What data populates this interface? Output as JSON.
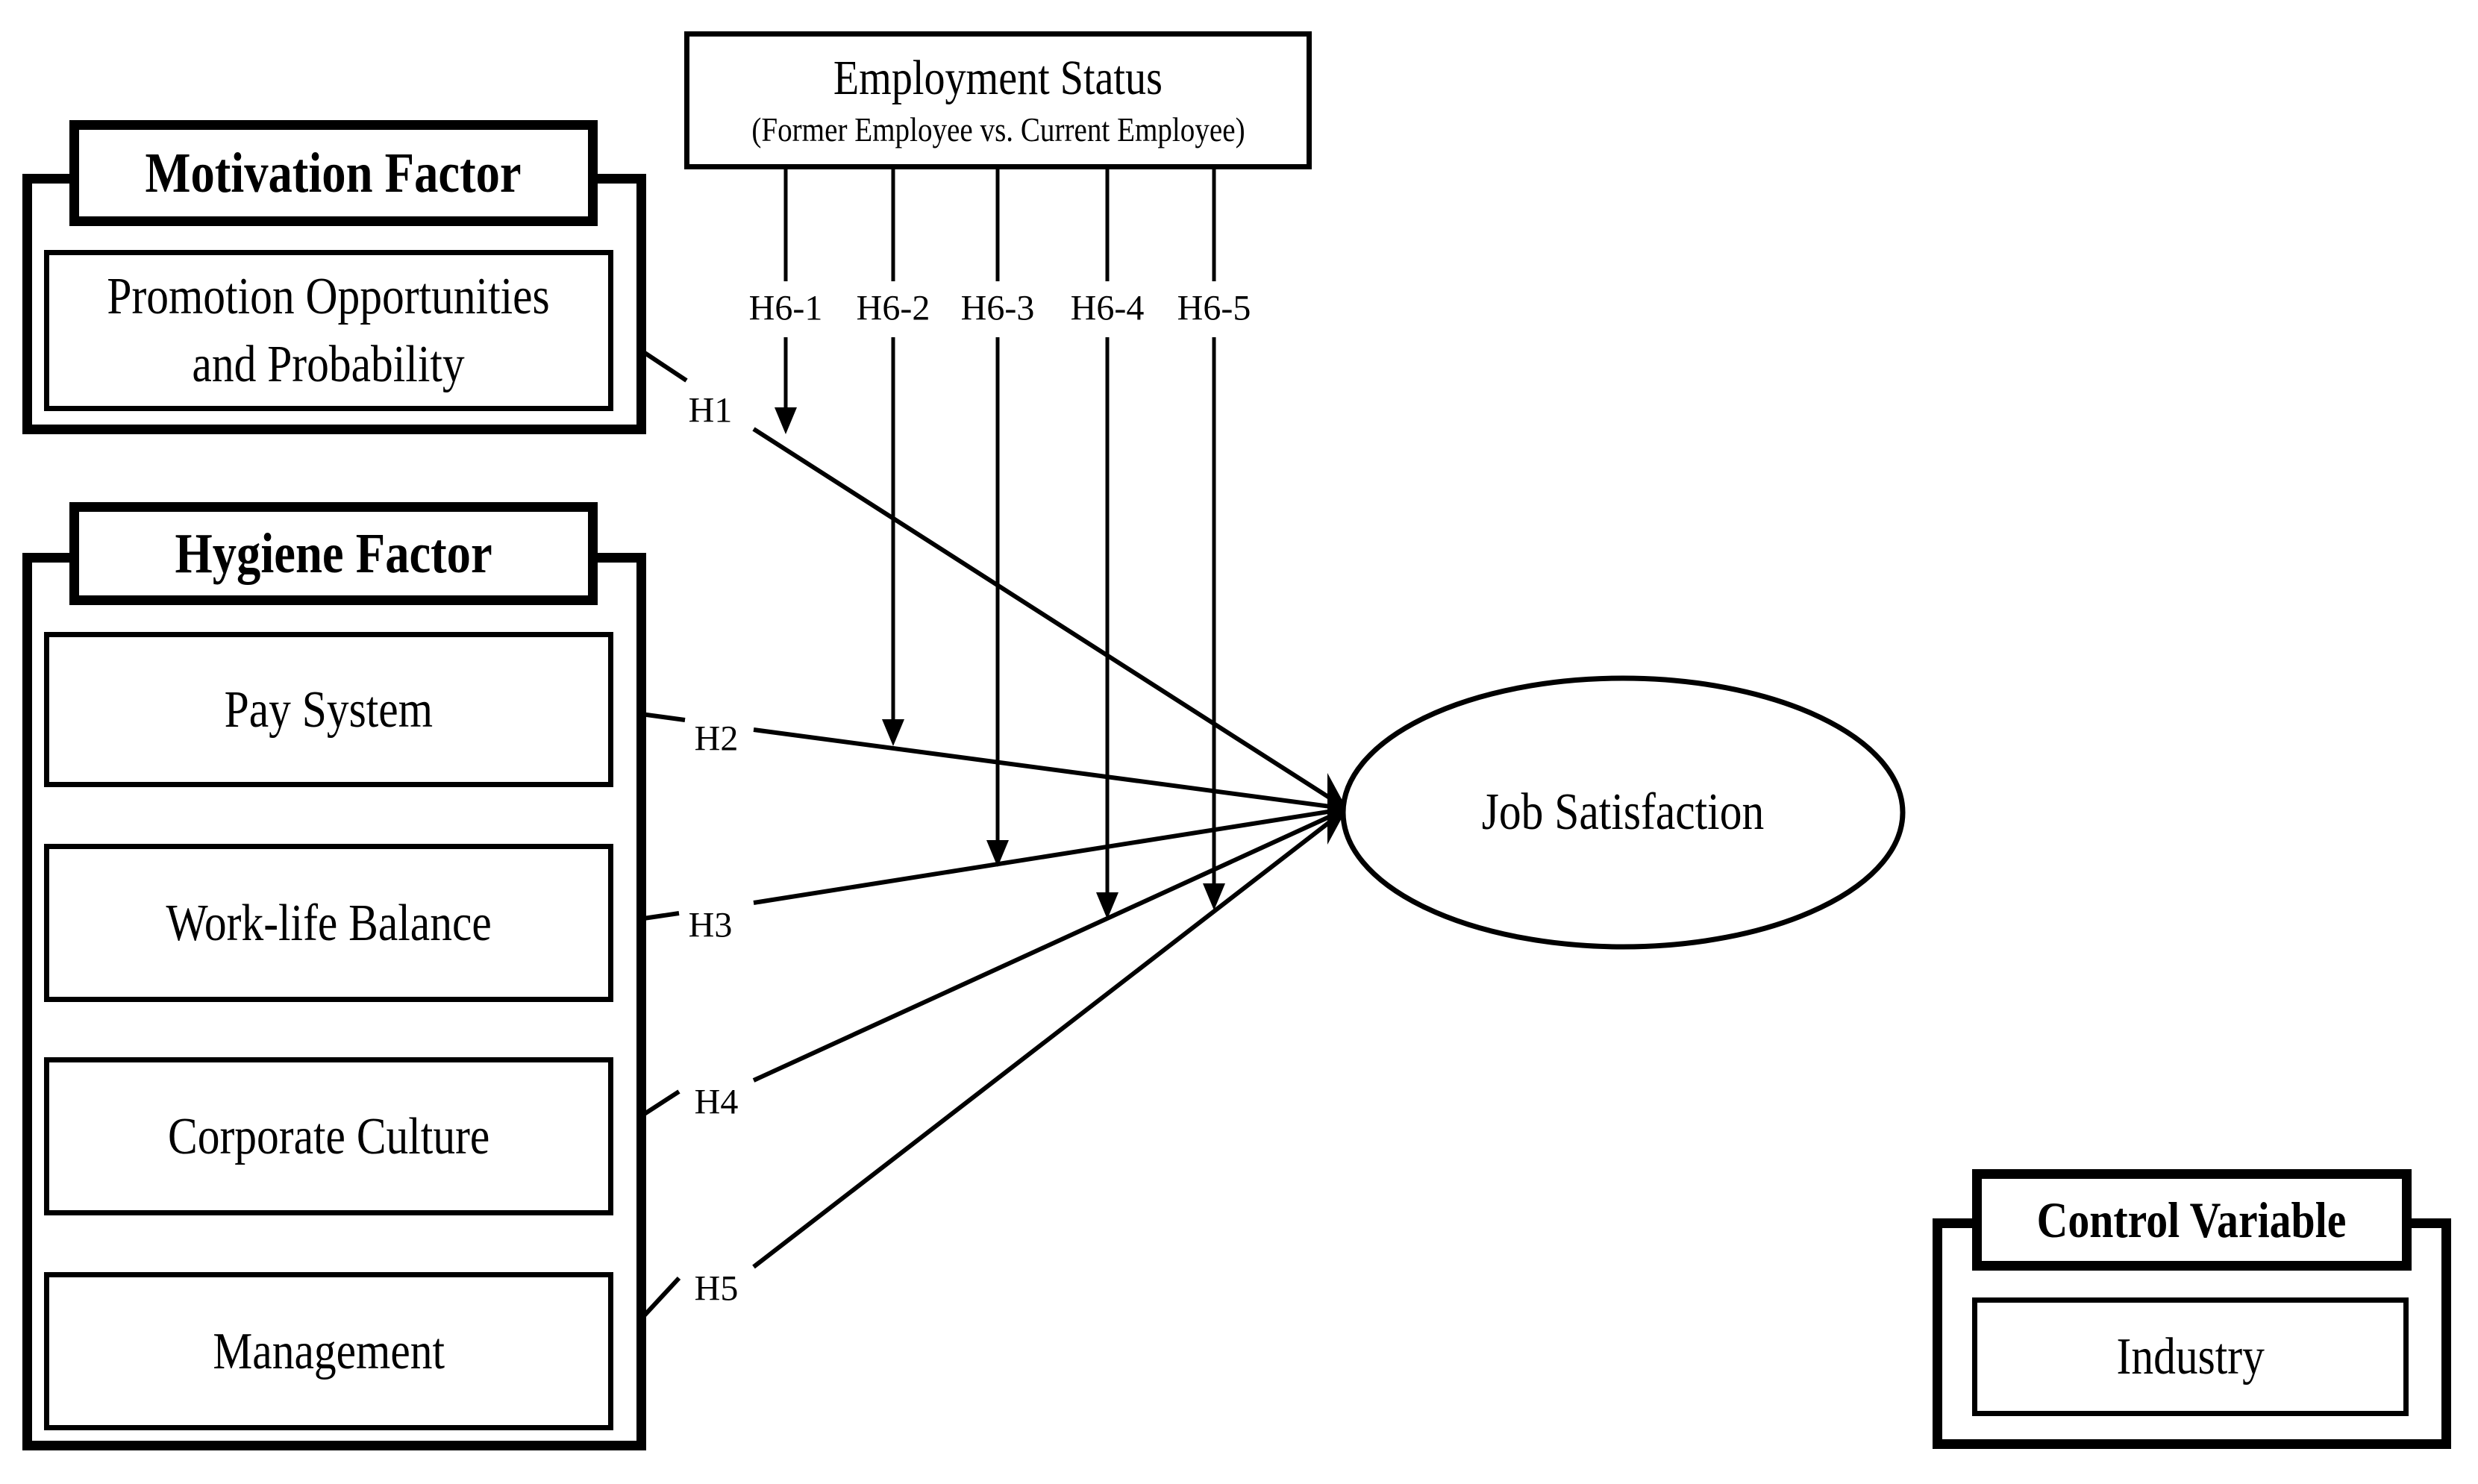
{
  "diagram": {
    "motivation_group": {
      "title": "Motivation Factor",
      "items": [
        "Promotion Opportunities\nand Probability"
      ]
    },
    "hygiene_group": {
      "title": "Hygiene Factor",
      "items": [
        "Pay System",
        "Work-life Balance",
        "Corporate Culture",
        "Management"
      ]
    },
    "moderator": {
      "title": "Employment Status",
      "subtitle": "(Former Employee vs. Current Employee)"
    },
    "outcome": "Job Satisfaction",
    "control_group": {
      "title": "Control Variable",
      "items": [
        "Industry"
      ]
    },
    "hypotheses": {
      "direct": [
        "H1",
        "H2",
        "H3",
        "H4",
        "H5"
      ],
      "moderation": [
        "H6-1",
        "H6-2",
        "H6-3",
        "H6-4",
        "H6-5"
      ]
    },
    "edges": [
      {
        "from": "Promotion Opportunities and Probability",
        "to": "Job Satisfaction",
        "label": "H1"
      },
      {
        "from": "Pay System",
        "to": "Job Satisfaction",
        "label": "H2"
      },
      {
        "from": "Work-life Balance",
        "to": "Job Satisfaction",
        "label": "H3"
      },
      {
        "from": "Corporate Culture",
        "to": "Job Satisfaction",
        "label": "H4"
      },
      {
        "from": "Management",
        "to": "Job Satisfaction",
        "label": "H5"
      },
      {
        "from": "Employment Status",
        "to": "H1 path",
        "label": "H6-1"
      },
      {
        "from": "Employment Status",
        "to": "H2 path",
        "label": "H6-2"
      },
      {
        "from": "Employment Status",
        "to": "H3 path",
        "label": "H6-3"
      },
      {
        "from": "Employment Status",
        "to": "H4 path",
        "label": "H6-4"
      },
      {
        "from": "Employment Status",
        "to": "H5 path",
        "label": "H6-5"
      }
    ]
  }
}
